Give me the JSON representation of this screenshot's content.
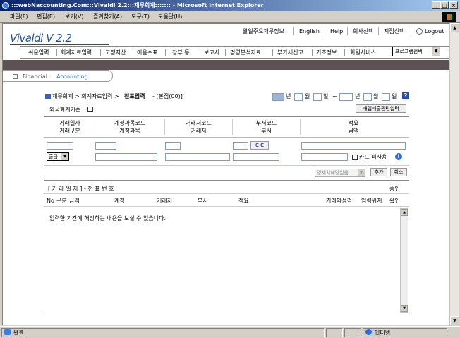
{
  "window": {
    "title": ":::webNaccounting.Com:::Vivaldi 2.2:::재무회계::::::: - Microsoft Internet Explorer",
    "min": "_",
    "max": "□",
    "close": "×"
  },
  "menubar": [
    "파일(F)",
    "편집(E)",
    "보기(V)",
    "즐겨찾기(A)",
    "도구(T)",
    "도움말(H)"
  ],
  "logo": "Vivaldi V 2.2",
  "toplinks": [
    "알일주요재무정보",
    "English",
    "Help",
    "회사선택",
    "지점선택",
    "Logout"
  ],
  "nav": [
    "쉬운입력",
    "회계자료입력",
    "고정자산",
    "어음수표",
    "장부 등",
    "보고서",
    "경영분석자료",
    "부가세신고",
    "기초정보",
    "회원서비스"
  ],
  "program_select": "프로그램선택",
  "crumb": {
    "financial": "Financial",
    "accounting": "Accounting"
  },
  "breadcrumb": {
    "path": "재무회계 > 회계자료입력 >",
    "current": "전표입력",
    "branch": "- [본점(00)]"
  },
  "date": {
    "year": "년",
    "month": "월",
    "day": "일",
    "tilde": "~",
    "year2": "년",
    "month2": "월",
    "day2": "일",
    "help": "?"
  },
  "foreign_label": "외국회계기준",
  "sales_button": "매입매출관련입력",
  "headers": [
    [
      "거래일자",
      "거래구분"
    ],
    [
      "계정과목코드",
      "계정과목"
    ],
    [
      "거래처코드",
      "거래처"
    ],
    [
      "부서코드",
      "부서"
    ],
    [
      "적요",
      "금액"
    ]
  ],
  "cc_button": "C·C",
  "type_select": "출금",
  "card_label": "카드 미사용",
  "info_icon": "i",
  "receipt_select": "영세치해당없음",
  "add_button": "추가",
  "cancel_button": "취소",
  "list_header": {
    "left": "[ 거 래 일 자 ] - 전 표 번 호",
    "right": "승인"
  },
  "columns": [
    "No",
    "구분",
    "금액",
    "계정",
    "거래처",
    "부서",
    "적요",
    "거래의성격",
    "입력위치",
    "확인"
  ],
  "empty_message": "입력한 기간에 해당하는 내용을 보실 수 있습니다.",
  "status": {
    "done": "완료",
    "zone": "인터넷"
  }
}
